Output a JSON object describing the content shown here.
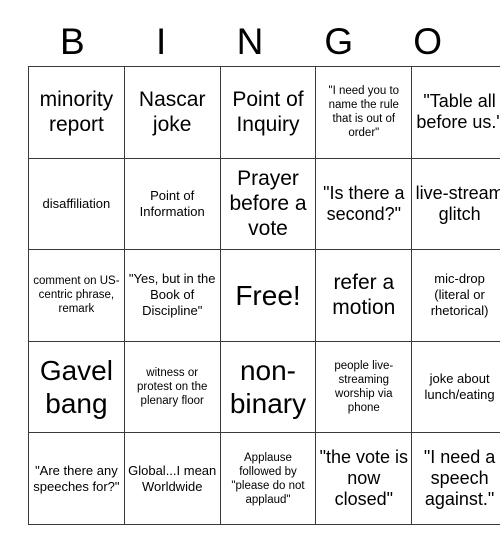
{
  "card": {
    "header_letters": [
      "B",
      "I",
      "N",
      "G",
      "O"
    ],
    "rows": [
      [
        {
          "text": "minority report",
          "size": "lg"
        },
        {
          "text": "Nascar joke",
          "size": "lg"
        },
        {
          "text": "Point of Inquiry",
          "size": "lg"
        },
        {
          "text": "\"I need you to name the rule that is out of order\"",
          "size": "xs"
        },
        {
          "text": "\"Table all before us.\"",
          "size": "md"
        }
      ],
      [
        {
          "text": "disaffiliation",
          "size": "sm"
        },
        {
          "text": "Point of Information",
          "size": "sm"
        },
        {
          "text": "Prayer before a vote",
          "size": "lg"
        },
        {
          "text": "\"Is there a second?\"",
          "size": "md"
        },
        {
          "text": "live-stream glitch",
          "size": "md"
        }
      ],
      [
        {
          "text": "comment on US-centric phrase, remark",
          "size": "xs"
        },
        {
          "text": "\"Yes, but in the Book of Discipline\"",
          "size": "sm"
        },
        {
          "text": "Free!",
          "size": "xl"
        },
        {
          "text": "refer a motion",
          "size": "lg"
        },
        {
          "text": "mic-drop (literal or rhetorical)",
          "size": "sm"
        }
      ],
      [
        {
          "text": "Gavel bang",
          "size": "xl"
        },
        {
          "text": "witness or protest on the plenary floor",
          "size": "xs"
        },
        {
          "text": "non-binary",
          "size": "xl"
        },
        {
          "text": "people live-streaming worship via phone",
          "size": "xs"
        },
        {
          "text": "joke about lunch/eating",
          "size": "sm"
        }
      ],
      [
        {
          "text": "\"Are there any speeches for?\"",
          "size": "sm"
        },
        {
          "text": "Global...I mean Worldwide",
          "size": "sm"
        },
        {
          "text": "Applause followed by \"please do not applaud\"",
          "size": "xs"
        },
        {
          "text": "\"the vote is now closed\"",
          "size": "md"
        },
        {
          "text": "\"I need a speech against.\"",
          "size": "md"
        }
      ]
    ]
  }
}
